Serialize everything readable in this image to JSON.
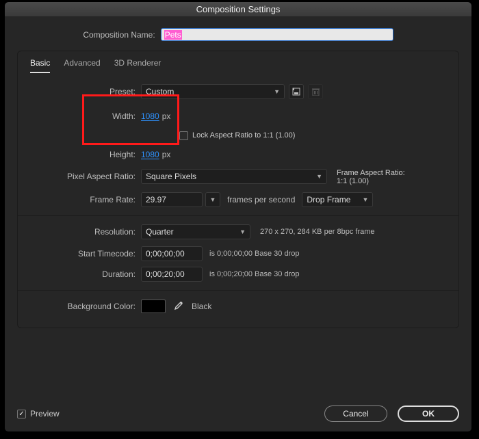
{
  "title": "Composition Settings",
  "compNameLabel": "Composition Name:",
  "compName": "Pets",
  "tabs": {
    "basic": "Basic",
    "advanced": "Advanced",
    "renderer": "3D Renderer"
  },
  "presetLabel": "Preset:",
  "presetValue": "Custom",
  "widthLabel": "Width:",
  "widthValue": "1080",
  "heightLabel": "Height:",
  "heightValue": "1080",
  "pxSuffix": "px",
  "lockAspect": "Lock Aspect Ratio to 1:1 (1.00)",
  "pixelARLabel": "Pixel Aspect Ratio:",
  "pixelARValue": "Square Pixels",
  "frameARLabel": "Frame Aspect Ratio:",
  "frameARValue": "1:1 (1.00)",
  "frameRateLabel": "Frame Rate:",
  "frameRateValue": "29.97",
  "fpsText": "frames per second",
  "dropFrame": "Drop Frame",
  "resolutionLabel": "Resolution:",
  "resolutionValue": "Quarter",
  "resolutionInfo": "270 x 270, 284 KB per 8bpc frame",
  "startTCLabel": "Start Timecode:",
  "startTCValue": "0;00;00;00",
  "startTCInfo": "is 0;00;00;00 Base 30  drop",
  "durationLabel": "Duration:",
  "durationValue": "0;00;20;00",
  "durationInfo": "is 0;00;20;00  Base 30  drop",
  "bgLabel": "Background Color:",
  "bgName": "Black",
  "previewLabel": "Preview",
  "cancel": "Cancel",
  "ok": "OK"
}
